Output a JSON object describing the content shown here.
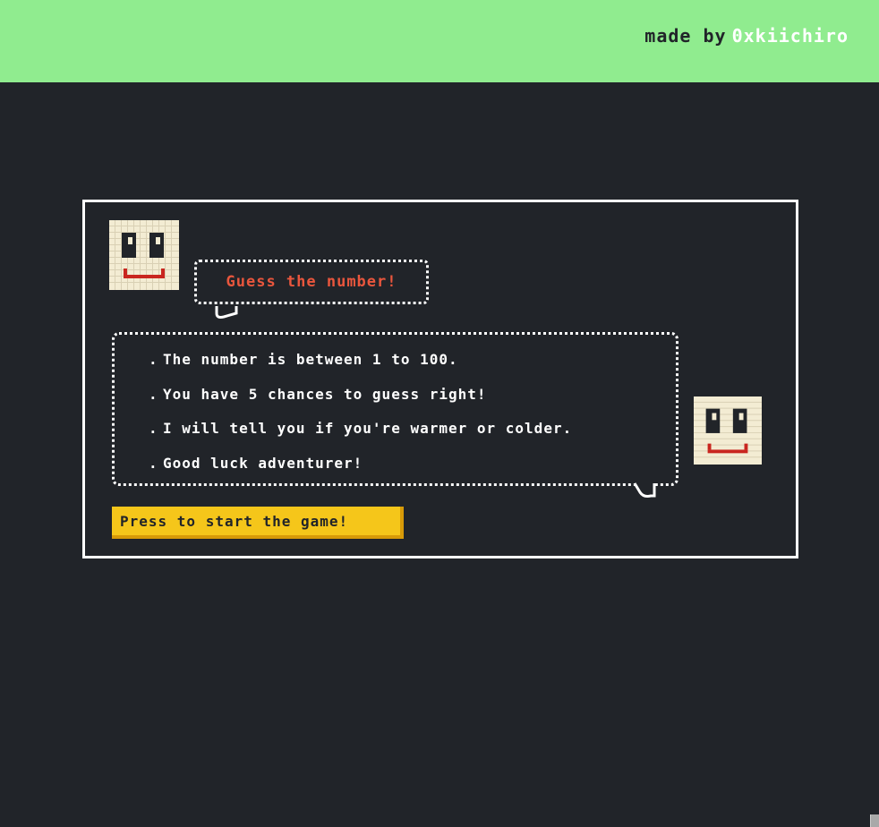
{
  "header": {
    "credit_prefix": "made by",
    "credit_author": "0xkiichiro"
  },
  "game": {
    "title": "Guess the number!",
    "rules": [
      "The number is between 1 to 100.",
      "You have 5 chances to guess right!",
      "I will tell you if you're warmer or colder.",
      "Good luck adventurer!"
    ],
    "bullet": ".",
    "start_label": "Press to start the game!"
  },
  "colors": {
    "header_bg": "#90ec8f",
    "page_bg": "#212429",
    "title_text": "#e9563d",
    "button_bg": "#f5c61a",
    "face_skin": "#f3ecd3",
    "face_mouth": "#c9261f"
  },
  "icons": {
    "character": "smiley-face-icon",
    "speech_tail": "speech-tail-icon"
  }
}
